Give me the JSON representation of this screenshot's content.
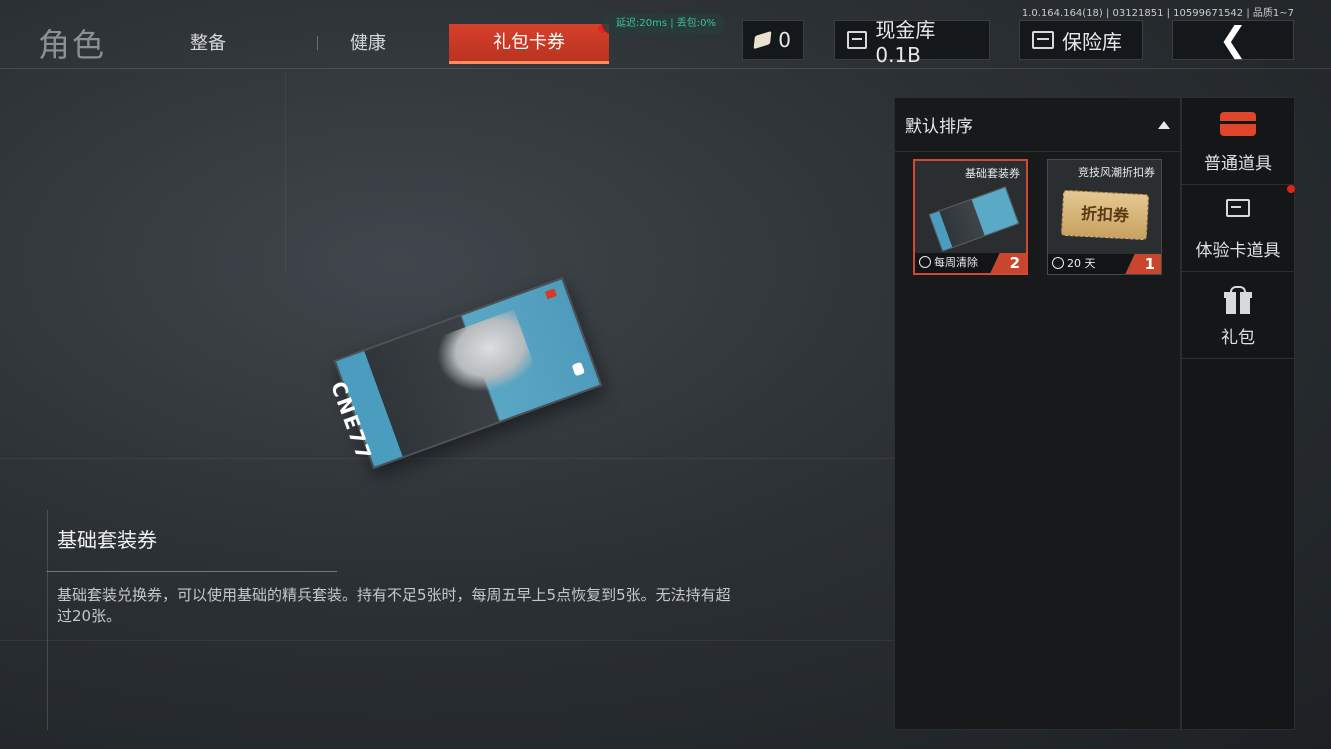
{
  "header": {
    "title": "角色",
    "tabs": [
      {
        "label": "整备"
      },
      {
        "label": "健康"
      },
      {
        "label": "礼包卡券"
      }
    ],
    "network_status": "延迟:20ms | 丢包:0%",
    "version": "1.0.164.164(18) | 03121851 | 10599671542 | 品质1~7",
    "ticket_count": "0",
    "cash_button": "现金库 0.1B",
    "vault_button": "保险库",
    "back_icon": "chevron-left-icon"
  },
  "selected_item": {
    "name": "基础套装券",
    "description": "基础套装兑换券，可以使用基础的精兵套装。持有不足5张时，每周五早上5点恢复到5张。无法持有超过20张。",
    "card_brand": "CNE77"
  },
  "inventory": {
    "sort_label": "默认排序",
    "items": [
      {
        "name": "基础套装券",
        "footer": "每周清除",
        "count": "2",
        "selected": true
      },
      {
        "name": "竞技风潮折扣券",
        "footer": "20 天",
        "count": "1",
        "art_text": "折扣券",
        "selected": false
      }
    ]
  },
  "sidenav": {
    "items": [
      {
        "label": "普通道具",
        "icon": "chest-icon"
      },
      {
        "label": "体验卡道具",
        "icon": "card-icon"
      },
      {
        "label": "礼包",
        "icon": "gift-icon"
      }
    ]
  },
  "colors": {
    "accent": "#d7402a",
    "notify": "#e0251d",
    "panel_bg": "#17191b"
  }
}
